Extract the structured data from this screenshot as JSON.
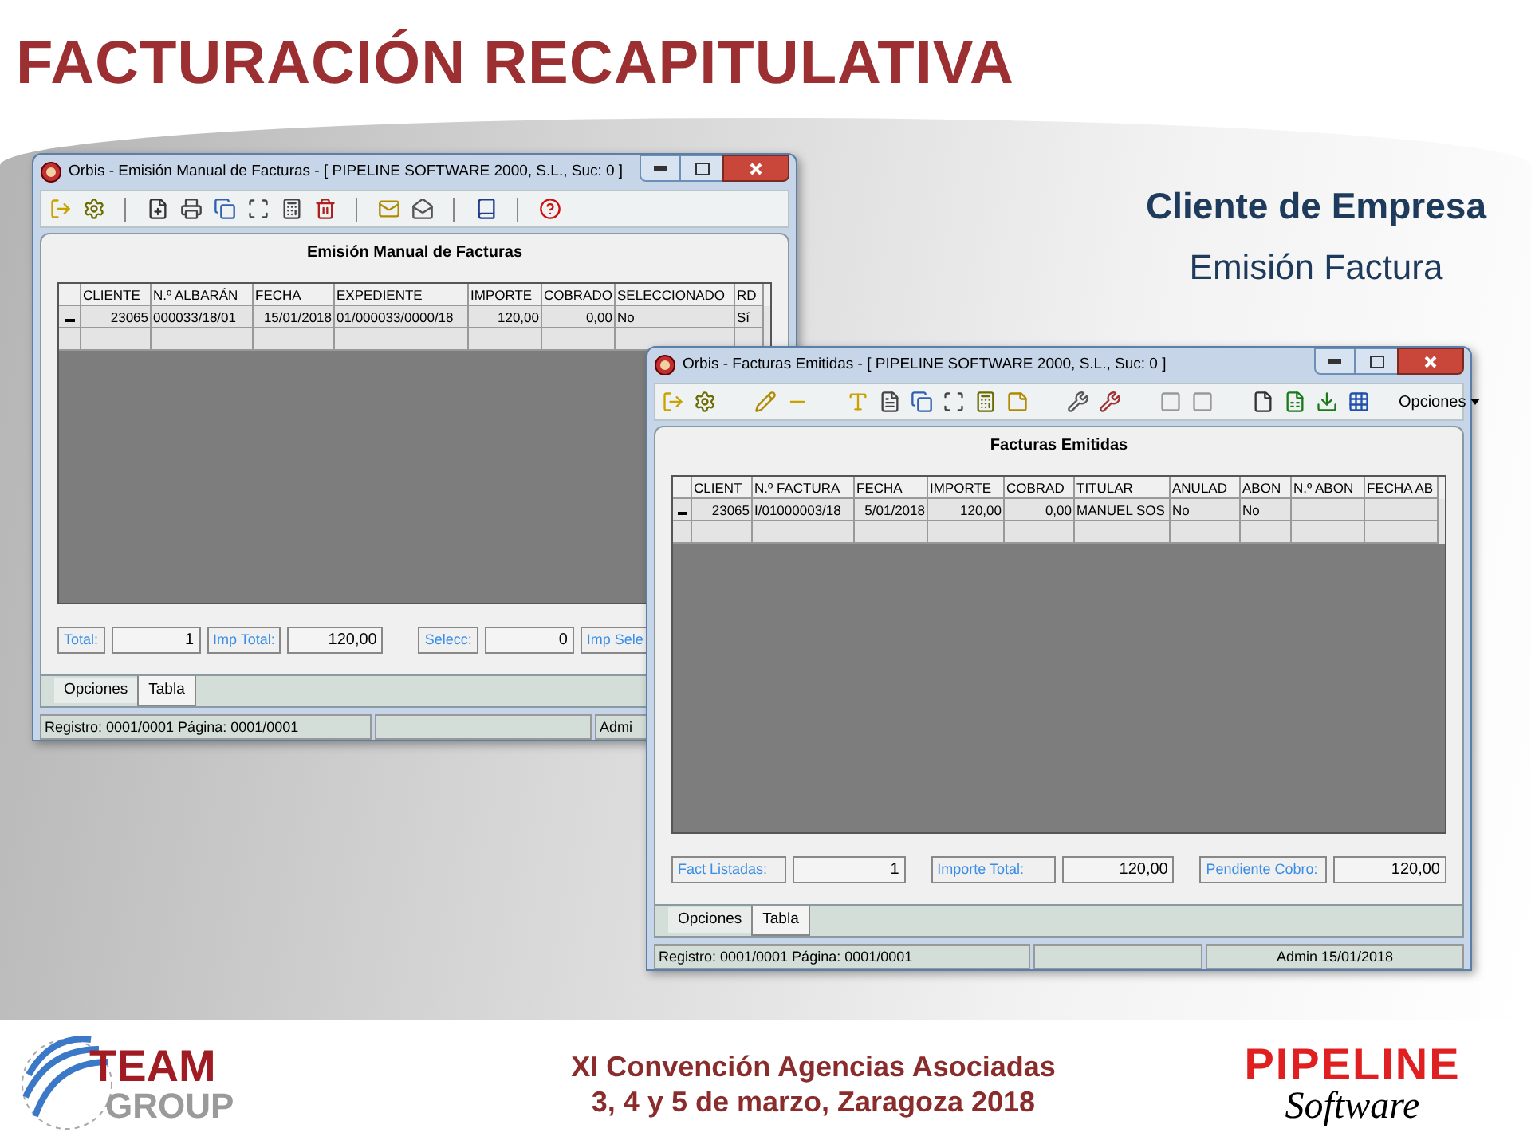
{
  "slide_title": "FACTURACIÓN RECAPITULATIVA",
  "subtitle": {
    "heading": "Cliente de Empresa",
    "text": "Emisión Factura"
  },
  "windows": [
    {
      "title": "Orbis - Emisión Manual de Facturas - [ PIPELINE SOFTWARE 2000, S.L.,  Suc: 0 ]",
      "panel_title": "Emisión Manual de Facturas",
      "columns": [
        {
          "label": "CLIENTE",
          "numeric": true
        },
        {
          "label": "N.º ALBARÁN",
          "numeric": false
        },
        {
          "label": "FECHA",
          "numeric": true
        },
        {
          "label": "EXPEDIENTE",
          "numeric": false
        },
        {
          "label": "IMPORTE",
          "numeric": true
        },
        {
          "label": "COBRADO",
          "numeric": true
        },
        {
          "label": "SELECCIONADO",
          "numeric": false
        },
        {
          "label": "RD",
          "numeric": false
        }
      ],
      "rows": [
        [
          "23065",
          "000033/18/01",
          "15/01/2018",
          "01/000033/0000/18",
          "120,00",
          "0,00",
          "No",
          "Sí"
        ]
      ],
      "summary": [
        {
          "label": "Total:",
          "value": "1"
        },
        {
          "label": "Imp Total:",
          "value": "120,00"
        },
        {
          "label": "Selecc:",
          "value": "0"
        },
        {
          "label": "Imp Sele"
        }
      ],
      "tabs": [
        {
          "label": "Opciones",
          "selected": false
        },
        {
          "label": "Tabla",
          "selected": true
        }
      ],
      "status_bar": {
        "left": "Registro: 0001/0001  Página: 0001/0001",
        "right": "Admi"
      }
    },
    {
      "title": "Orbis - Facturas Emitidas - [ PIPELINE SOFTWARE 2000, S.L.,  Suc: 0 ]",
      "panel_title": "Facturas Emitidas",
      "toolbar_menu": "Opciones",
      "columns": [
        {
          "label": "CLIENT",
          "numeric": true
        },
        {
          "label": "N.º FACTURA",
          "numeric": false
        },
        {
          "label": "FECHA",
          "numeric": true
        },
        {
          "label": "IMPORTE",
          "numeric": true
        },
        {
          "label": "COBRAD",
          "numeric": true
        },
        {
          "label": "TITULAR",
          "numeric": false
        },
        {
          "label": "ANULAD",
          "numeric": false
        },
        {
          "label": "ABON",
          "numeric": false
        },
        {
          "label": "N.º ABON"
        },
        {
          "label": "FECHA AB"
        }
      ],
      "rows": [
        [
          "23065",
          "I/01000003/18",
          "5/01/2018",
          "120,00",
          "0,00",
          "MANUEL SOS",
          "No",
          "No",
          null,
          null
        ]
      ],
      "summary": [
        {
          "label": "Fact Listadas:",
          "value": "1"
        },
        {
          "label": "Importe Total:",
          "value": "120,00"
        },
        {
          "label": "Pendiente Cobro:",
          "value": "120,00"
        }
      ],
      "tabs": [
        {
          "label": "Opciones",
          "selected": false
        },
        {
          "label": "Tabla",
          "selected": true
        }
      ],
      "status_bar": {
        "left": "Registro: 0001/0001  Página: 0001/0001",
        "right": "Admin 15/01/2018"
      }
    }
  ],
  "footer": {
    "event_lines": [
      "XI Convención Agencias Asociadas",
      "3, 4 y 5 de marzo, Zaragoza 2018"
    ],
    "team_logo": {
      "top": "TEAM",
      "bottom": "GROUP"
    },
    "pipeline_logo": {
      "top": "PIPELINE",
      "bottom": "Software"
    }
  }
}
